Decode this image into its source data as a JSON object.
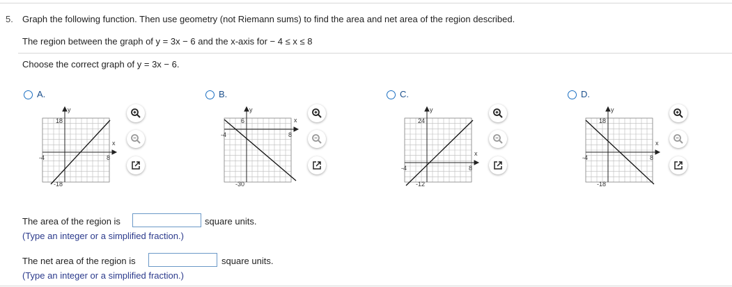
{
  "question": {
    "number": "5.",
    "prompt": "Graph the following function. Then use geometry (not Riemann sums) to find the area and net area of the region described.",
    "region_text": "The region between the graph of y = 3x − 6 and the x-axis for  − 4 ≤ x ≤ 8",
    "instruction": "Choose the correct graph of y = 3x − 6."
  },
  "options": [
    {
      "label": "A.",
      "axis_x": "x",
      "axis_y": "y",
      "x_min": "-4",
      "x_max": "8",
      "y_top": "18",
      "y_bottom": "-18"
    },
    {
      "label": "B.",
      "axis_x": "x",
      "axis_y": "y",
      "x_min": "-4",
      "x_max": "8",
      "y_top": "6",
      "y_bottom": "-30"
    },
    {
      "label": "C.",
      "axis_x": "x",
      "axis_y": "y",
      "x_min": "-4",
      "x_max": "8",
      "y_top": "24",
      "y_bottom": "-12"
    },
    {
      "label": "D.",
      "axis_x": "x",
      "axis_y": "y",
      "x_min": "-4",
      "x_max": "8",
      "y_top": "18",
      "y_bottom": "-18"
    }
  ],
  "area": {
    "label": "The area of the region is",
    "value": "",
    "units": "square units.",
    "hint": "(Type an integer or a simplified fraction.)"
  },
  "net_area": {
    "label": "The net area of the region is",
    "value": "",
    "units": "square units.",
    "hint": "(Type an integer or a simplified fraction.)"
  },
  "icons": {
    "zoom_in": "zoom-in-icon",
    "zoom_out": "zoom-out-icon",
    "enlarge": "open-new-window-icon"
  },
  "colors": {
    "radio": "#1b6fc2",
    "hint": "#2b3a8c",
    "input_border": "#6a98c7"
  }
}
